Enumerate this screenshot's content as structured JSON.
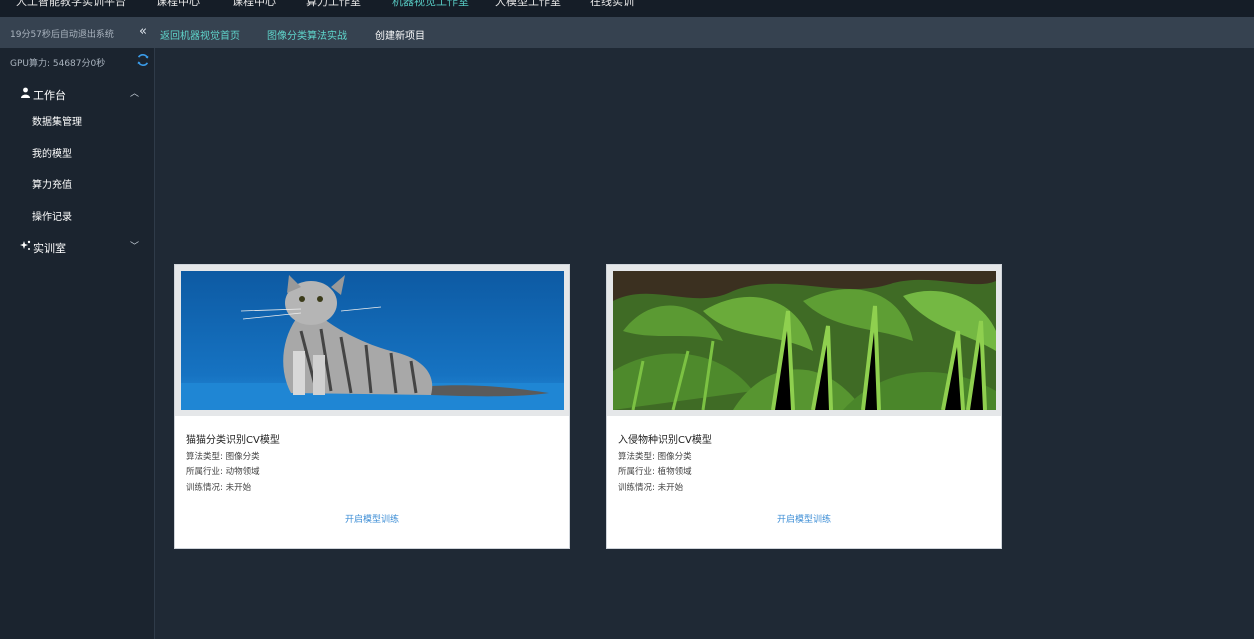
{
  "topnav": {
    "items": [
      {
        "label": "人工智能教学实训平台",
        "active": false
      },
      {
        "label": "课程中心",
        "active": false
      },
      {
        "label": "课程中心",
        "active": false
      },
      {
        "label": "算力工作室",
        "active": false
      },
      {
        "label": "机器视觉工作室",
        "active": true
      },
      {
        "label": "大模型工作室",
        "active": false
      },
      {
        "label": "在线实训",
        "active": false
      }
    ]
  },
  "subbar": {
    "countdown": "19分57秒后自动退出系统",
    "breadcrumbs": [
      "返回机器视觉首页",
      "图像分类算法实战",
      "创建新项目"
    ]
  },
  "sidebar": {
    "gpu": "GPU算力: 54687分0秒",
    "workbench": {
      "label": "工作台",
      "items": [
        "数据集管理",
        "我的模型",
        "算力充值",
        "操作记录"
      ]
    },
    "lab": {
      "label": "实训室"
    }
  },
  "cards": [
    {
      "title": "猫猫分类识别CV模型",
      "algo": "算法类型: 图像分类",
      "industry": "所属行业: 动物领域",
      "status": "训练情况: 未开始",
      "action": "开启模型训练"
    },
    {
      "title": "入侵物种识别CV模型",
      "algo": "算法类型: 图像分类",
      "industry": "所属行业: 植物领域",
      "status": "训练情况: 未开始",
      "action": "开启模型训练"
    }
  ],
  "colors": {
    "accent": "#5fd6cc",
    "link": "#3f8fd6",
    "background": "#1f2935"
  }
}
